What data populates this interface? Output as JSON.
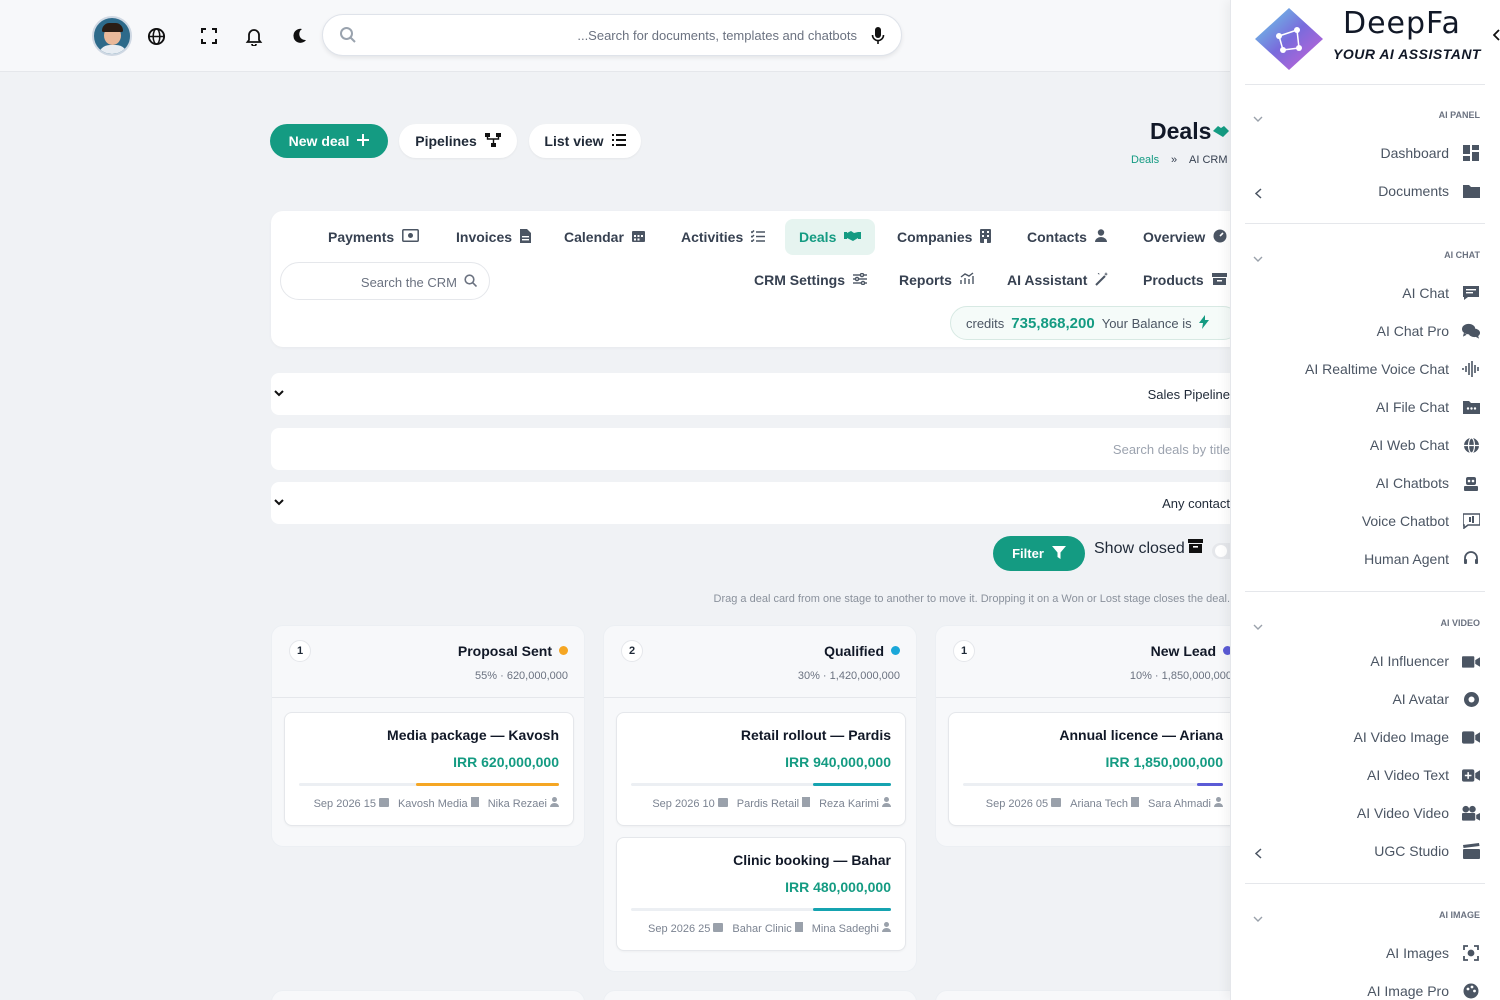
{
  "topbar": {
    "search_placeholder": "...Search for documents, templates and chatbots",
    "icons": [
      "globe-icon",
      "fullscreen-icon",
      "bell-icon",
      "moon-icon",
      "search-icon",
      "mic-icon"
    ]
  },
  "actions": {
    "new_deal": "New deal",
    "pipelines": "Pipelines",
    "list_view": "List view"
  },
  "header": {
    "title": "Deals",
    "breadcrumb": [
      "Deals",
      "»",
      "AI CRM"
    ]
  },
  "tabs_row1": [
    {
      "label": "Payments",
      "icon": "payments-icon"
    },
    {
      "label": "Invoices",
      "icon": "invoice-icon"
    },
    {
      "label": "Calendar",
      "icon": "calendar-icon"
    },
    {
      "label": "Activities",
      "icon": "list-check-icon"
    },
    {
      "label": "Deals",
      "icon": "handshake-icon",
      "active": true
    },
    {
      "label": "Companies",
      "icon": "building-icon"
    },
    {
      "label": "Contacts",
      "icon": "user-icon"
    },
    {
      "label": "Overview",
      "icon": "gauge-icon"
    }
  ],
  "tabs_row2": [
    {
      "label": "CRM Settings",
      "icon": "sliders-icon"
    },
    {
      "label": "Reports",
      "icon": "chart-icon"
    },
    {
      "label": "AI Assistant",
      "icon": "magic-wand-icon"
    },
    {
      "label": "Products",
      "icon": "box-icon"
    }
  ],
  "crm_search_placeholder": "Search the CRM",
  "credits": {
    "label": "credits",
    "value": "735,868,200",
    "suffix": "Your Balance is"
  },
  "filters": {
    "pipeline": "Sales Pipeline",
    "title_placeholder": "Search deals by title",
    "contact": "Any contact",
    "filter_button": "Filter",
    "show_closed": "Show closed",
    "hint": "Drag a deal card from one stage to another to move it. Dropping it on a Won or Lost stage closes the deal."
  },
  "stages": [
    {
      "count": "1",
      "name": "Proposal Sent",
      "dot_color": "#f5a623",
      "meta": "55% · 620,000,000",
      "deals": [
        {
          "title": "Media package — Kavosh",
          "amount": "IRR 620,000,000",
          "progress": 0.55,
          "bar_color": "#f5a623",
          "date": "Sep 2026 15",
          "company": "Kavosh Media",
          "contact": "Nika Rezaei"
        }
      ]
    },
    {
      "count": "2",
      "name": "Qualified",
      "dot_color": "#1aa7d9",
      "meta": "30% · 1,420,000,000",
      "deals": [
        {
          "title": "Retail rollout — Pardis",
          "amount": "IRR 940,000,000",
          "progress": 0.3,
          "bar_color": "#15a3b0",
          "date": "Sep 2026 10",
          "company": "Pardis Retail",
          "contact": "Reza Karimi"
        },
        {
          "title": "Clinic booking — Bahar",
          "amount": "IRR 480,000,000",
          "progress": 0.3,
          "bar_color": "#15a3b0",
          "date": "Sep 2026 25",
          "company": "Bahar Clinic",
          "contact": "Mina Sadeghi"
        }
      ]
    },
    {
      "count": "1",
      "name": "New Lead",
      "dot_color": "#5b5bd6",
      "meta": "10% · 1,850,000,000",
      "deals": [
        {
          "title": "Annual licence — Ariana",
          "amount": "IRR 1,850,000,000",
          "progress": 0.1,
          "bar_color": "#5b5bd6",
          "date": "Sep 2026 05",
          "company": "Ariana Tech",
          "contact": "Sara Ahmadi"
        }
      ]
    }
  ],
  "panel": {
    "brand": "DeepFa",
    "tagline": "YOUR AI ASSISTANT",
    "sections": [
      {
        "title": "AI PANEL",
        "items": [
          {
            "label": "Dashboard",
            "icon": "dashboard-icon"
          },
          {
            "label": "Documents",
            "icon": "folder-icon"
          }
        ]
      },
      {
        "title": "AI CHAT",
        "items": [
          {
            "label": "AI Chat",
            "icon": "chat-icon"
          },
          {
            "label": "AI Chat Pro",
            "icon": "comments-icon"
          },
          {
            "label": "AI Realtime Voice Chat",
            "icon": "waveform-icon"
          },
          {
            "label": "AI File Chat",
            "icon": "file-chat-icon"
          },
          {
            "label": "AI Web Chat",
            "icon": "globe-icon"
          },
          {
            "label": "AI Chatbots",
            "icon": "robot-icon"
          },
          {
            "label": "Voice Chatbot",
            "icon": "voice-chat-icon"
          },
          {
            "label": "Human Agent",
            "icon": "headset-icon"
          }
        ]
      },
      {
        "title": "AI VIDEO",
        "items": [
          {
            "label": "AI Influencer",
            "icon": "video-user-icon"
          },
          {
            "label": "AI Avatar",
            "icon": "aperture-icon"
          },
          {
            "label": "AI Video Image",
            "icon": "video-camera-icon"
          },
          {
            "label": "AI Video Text",
            "icon": "video-plus-icon"
          },
          {
            "label": "AI Video Video",
            "icon": "film-camera-icon"
          },
          {
            "label": "UGC Studio",
            "icon": "clapper-icon"
          }
        ]
      },
      {
        "title": "AI IMAGE",
        "items": [
          {
            "label": "AI Images",
            "icon": "image-scan-icon"
          },
          {
            "label": "AI Image Pro",
            "icon": "palette-icon"
          }
        ]
      }
    ]
  },
  "colors": {
    "accent": "#149b82",
    "background": "#f0f2f5"
  }
}
